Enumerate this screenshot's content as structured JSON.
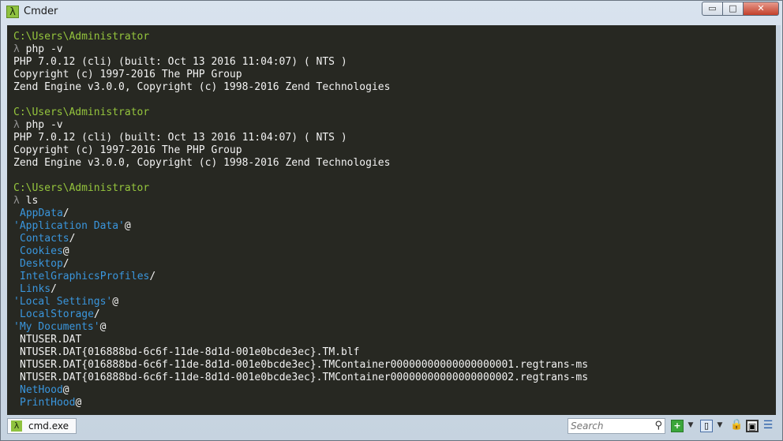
{
  "window": {
    "title": "Cmder",
    "app_icon_glyph": "λ",
    "controls": {
      "minimize": "▭",
      "maximize": "□",
      "close": "✕"
    }
  },
  "console": {
    "lines": [
      {
        "text": "C:\\Users\\Administrator",
        "style": "green"
      },
      {
        "prompt": "λ",
        "text": " php -v"
      },
      {
        "text": "PHP 7.0.12 (cli) (built: Oct 13 2016 11:04:07) ( NTS )"
      },
      {
        "text": "Copyright (c) 1997-2016 The PHP Group"
      },
      {
        "text": "Zend Engine v3.0.0, Copyright (c) 1998-2016 Zend Technologies"
      },
      {
        "text": ""
      },
      {
        "text": "C:\\Users\\Administrator",
        "style": "green"
      },
      {
        "prompt": "λ",
        "text": " php -v"
      },
      {
        "text": "PHP 7.0.12 (cli) (built: Oct 13 2016 11:04:07) ( NTS )"
      },
      {
        "text": "Copyright (c) 1997-2016 The PHP Group"
      },
      {
        "text": "Zend Engine v3.0.0, Copyright (c) 1998-2016 Zend Technologies"
      },
      {
        "text": ""
      },
      {
        "text": "C:\\Users\\Administrator",
        "style": "green"
      },
      {
        "prompt": "λ",
        "text": " ls"
      },
      {
        "name": "AppData",
        "suffix": "/",
        "style": "blue",
        "indent": true
      },
      {
        "name": "'Application Data'",
        "suffix": "@",
        "style": "blue"
      },
      {
        "name": "Contacts",
        "suffix": "/",
        "style": "blue",
        "indent": true
      },
      {
        "name": "Cookies",
        "suffix": "@",
        "style": "blue",
        "indent": true
      },
      {
        "name": "Desktop",
        "suffix": "/",
        "style": "blue",
        "indent": true
      },
      {
        "name": "IntelGraphicsProfiles",
        "suffix": "/",
        "style": "blue",
        "indent": true
      },
      {
        "name": "Links",
        "suffix": "/",
        "style": "blue",
        "indent": true
      },
      {
        "name": "'Local Settings'",
        "suffix": "@",
        "style": "blue"
      },
      {
        "name": "LocalStorage",
        "suffix": "/",
        "style": "blue",
        "indent": true
      },
      {
        "name": "'My Documents'",
        "suffix": "@",
        "style": "blue"
      },
      {
        "text": "NTUSER.DAT",
        "indent": true
      },
      {
        "text": "NTUSER.DAT{016888bd-6c6f-11de-8d1d-001e0bcde3ec}.TM.blf",
        "indent": true
      },
      {
        "text": "NTUSER.DAT{016888bd-6c6f-11de-8d1d-001e0bcde3ec}.TMContainer00000000000000000001.regtrans-ms",
        "indent": true
      },
      {
        "text": "NTUSER.DAT{016888bd-6c6f-11de-8d1d-001e0bcde3ec}.TMContainer00000000000000000002.regtrans-ms",
        "indent": true
      },
      {
        "name": "NetHood",
        "suffix": "@",
        "style": "blue",
        "indent": true
      },
      {
        "name": "PrintHood",
        "suffix": "@",
        "style": "blue",
        "indent": true
      }
    ]
  },
  "statusbar": {
    "tab_label": "cmd.exe",
    "tab_icon_glyph": "λ",
    "search_placeholder": "Search",
    "icons": {
      "search": "⚲",
      "new_console": "+",
      "dropdown": "▼",
      "split": "▯",
      "lock": "🔒",
      "panes": "▣",
      "menu": "☰"
    }
  },
  "colors": {
    "console_bg": "#272822",
    "prompt_path": "#95c53d",
    "directory": "#3a96dd",
    "text": "#f2f2f2"
  }
}
